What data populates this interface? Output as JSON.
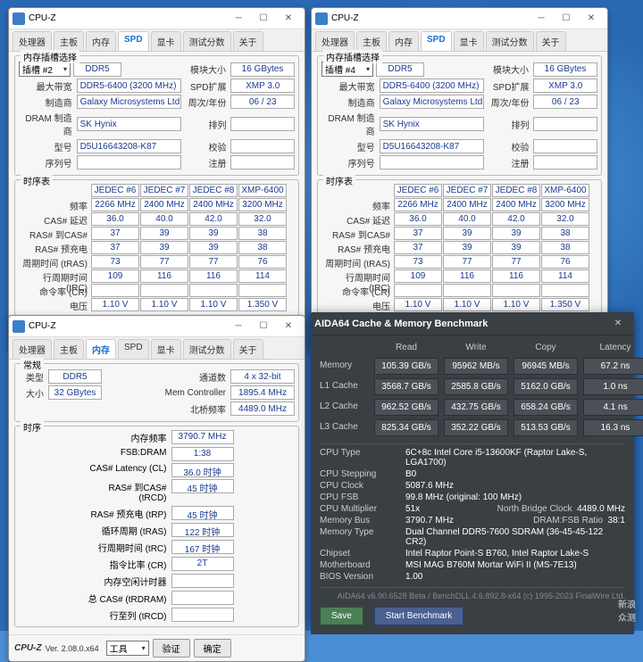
{
  "cpuz": {
    "title": "CPU-Z",
    "tabs": [
      "处理器",
      "主板",
      "内存",
      "SPD",
      "显卡",
      "测试分数",
      "关于"
    ],
    "version": "Ver. 2.08.0.x64",
    "buttons": {
      "tools": "工具",
      "validate": "验证",
      "ok": "确定"
    }
  },
  "spd1": {
    "slotLabel": "插槽 #2",
    "memType": "DDR5",
    "maxBwLabel": "最大带宽",
    "maxBw": "DDR5-6400 (3200 MHz)",
    "mfgLabel": "制造商",
    "mfg": "Galaxy Microsystems Ltd.",
    "dramMfgLabel": "DRAM 制造商",
    "dramMfg": "SK Hynix",
    "pnLabel": "型号",
    "pn": "D5U16643208-K87",
    "snLabel": "序列号",
    "modSizeLabel": "模块大小",
    "modSize": "16 GBytes",
    "spdExtLabel": "SPD扩展",
    "spdExt": "XMP 3.0",
    "wkyrLabel": "周次/年份",
    "wkyr": "06 / 23",
    "rankLabel": "排列",
    "regLabel": "校验",
    "注册": "注册",
    "timingGroup": "时序表",
    "timHeaders": [
      "JEDEC #6",
      "JEDEC #7",
      "JEDEC #8",
      "XMP-6400"
    ],
    "timRows": [
      {
        "l": "频率",
        "v": [
          "2266 MHz",
          "2400 MHz",
          "2400 MHz",
          "3200 MHz"
        ]
      },
      {
        "l": "CAS# 延迟",
        "v": [
          "36.0",
          "40.0",
          "42.0",
          "32.0"
        ]
      },
      {
        "l": "RAS# 到CAS#",
        "v": [
          "37",
          "39",
          "39",
          "38"
        ]
      },
      {
        "l": "RAS# 预充电",
        "v": [
          "37",
          "39",
          "39",
          "38"
        ]
      },
      {
        "l": "周期时间 (tRAS)",
        "v": [
          "73",
          "77",
          "77",
          "76"
        ]
      },
      {
        "l": "行周期时间 (tRC)",
        "v": [
          "109",
          "116",
          "116",
          "114"
        ]
      },
      {
        "l": "命令率 (CR)",
        "v": [
          "",
          "",
          "",
          ""
        ]
      },
      {
        "l": "电压",
        "v": [
          "1.10 V",
          "1.10 V",
          "1.10 V",
          "1.350 V"
        ]
      }
    ]
  },
  "spd2": {
    "slotLabel": "插槽 #4"
  },
  "mem": {
    "gen": "常规",
    "typeLabel": "类型",
    "type": "DDR5",
    "sizeLabel": "大小",
    "size": "32 GBytes",
    "chanLabel": "通道数",
    "chan": "4 x 32-bit",
    "mcLabel": "Mem Controller",
    "mc": "1895.4 MHz",
    "nbLabel": "北桥频率",
    "nb": "4489.0 MHz",
    "timGroup": "时序",
    "rows": [
      {
        "l": "内存频率",
        "v": "3790.7 MHz"
      },
      {
        "l": "FSB:DRAM",
        "v": "1:38"
      },
      {
        "l": "CAS# Latency (CL)",
        "v": "36.0 时钟"
      },
      {
        "l": "RAS# 到CAS# (tRCD)",
        "v": "45 时钟"
      },
      {
        "l": "RAS# 预充电 (tRP)",
        "v": "45 时钟"
      },
      {
        "l": "循环周期 (tRAS)",
        "v": "122 时钟"
      },
      {
        "l": "行周期时间 (tRC)",
        "v": "167 时钟"
      },
      {
        "l": "指令比率 (CR)",
        "v": "2T"
      },
      {
        "l": "内存空闲计时器",
        "v": ""
      },
      {
        "l": "总 CAS# (tRDRAM)",
        "v": ""
      },
      {
        "l": "行至列 (tRCD)",
        "v": ""
      }
    ]
  },
  "aida": {
    "title": "AIDA64 Cache & Memory Benchmark",
    "cols": [
      "Read",
      "Write",
      "Copy",
      "Latency"
    ],
    "rows": [
      {
        "l": "Memory",
        "v": [
          "105.39 GB/s",
          "95962 MB/s",
          "96945 MB/s",
          "67.2 ns"
        ]
      },
      {
        "l": "L1 Cache",
        "v": [
          "3568.7 GB/s",
          "2585.8 GB/s",
          "5162.0 GB/s",
          "1.0 ns"
        ]
      },
      {
        "l": "L2 Cache",
        "v": [
          "962.52 GB/s",
          "432.75 GB/s",
          "658.24 GB/s",
          "4.1 ns"
        ]
      },
      {
        "l": "L3 Cache",
        "v": [
          "825.34 GB/s",
          "352.22 GB/s",
          "513.53 GB/s",
          "16.3 ns"
        ]
      }
    ],
    "info": [
      {
        "k": "CPU Type",
        "v": "6C+8c Intel Core i5-13600KF (Raptor Lake-S, LGA1700)"
      },
      {
        "k": "CPU Stepping",
        "v": "B0"
      },
      {
        "k": "CPU Clock",
        "v": "5087.6 MHz"
      },
      {
        "k": "CPU FSB",
        "v": "99.8 MHz (original: 100 MHz)"
      },
      {
        "k": "CPU Multiplier",
        "v": "51x"
      },
      {
        "k": "Memory Bus",
        "v": "3790.7 MHz"
      },
      {
        "k": "Memory Type",
        "v": "Dual Channel DDR5-7600 SDRAM  (36-45-45-122 CR2)"
      },
      {
        "k": "Chipset",
        "v": "Intel Raptor Point-S B760, Intel Raptor Lake-S"
      },
      {
        "k": "Motherboard",
        "v": "MSI MAG B760M Mortar WiFi II (MS-7E13)"
      },
      {
        "k": "BIOS Version",
        "v": "1.00"
      }
    ],
    "nbClockLabel": "North Bridge Clock",
    "nbClock": "4489.0 MHz",
    "dramRatioLabel": "DRAM:FSB Ratio",
    "dramRatio": "38:1",
    "footer": "AIDA64 v6.90.6528 Beta / BenchDLL 4.6.892.8-x64  (c) 1995-2023 FinalWire Ltd.",
    "save": "Save",
    "start": "Start Benchmark"
  },
  "watermark": {
    "l1": "新浪",
    "l2": "众测"
  }
}
